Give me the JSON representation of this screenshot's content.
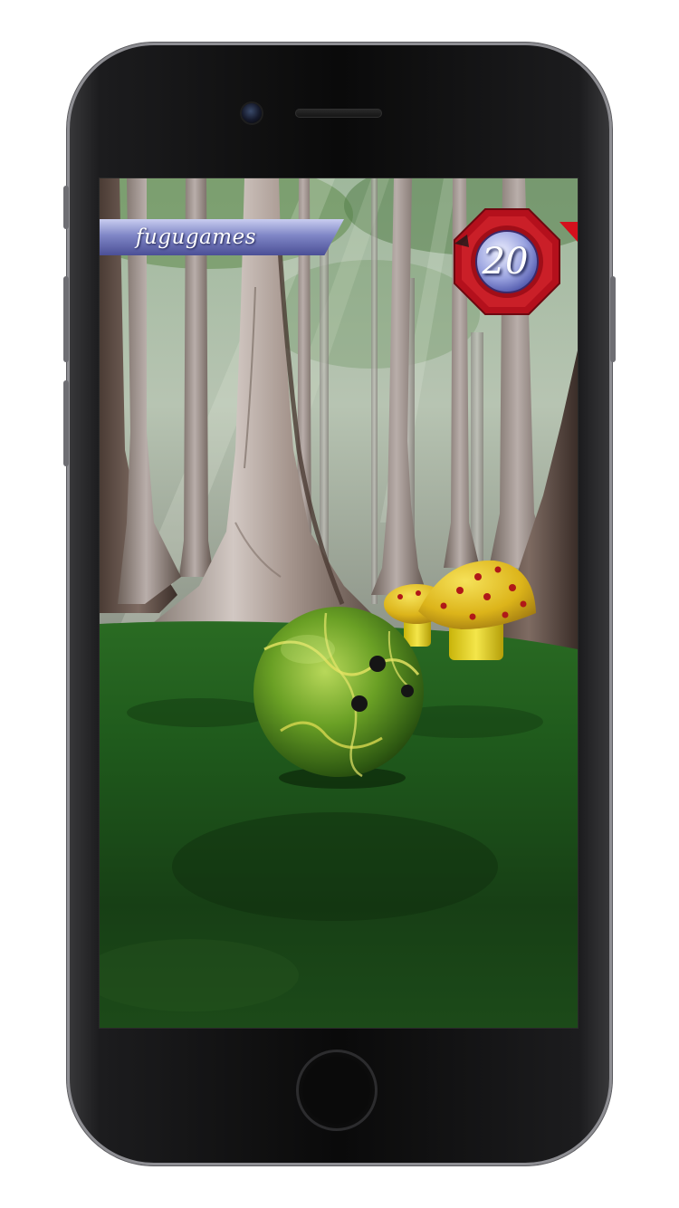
{
  "game": {
    "player_name": "fugugames",
    "timer_value": "20"
  },
  "colors": {
    "banner": "#7f86c6",
    "timer_ring": "#c0141e",
    "ball": "#6aa025",
    "mushroom_cap": "#e0b818",
    "mushroom_spot": "#b01818",
    "grass": "#1e5a1e"
  },
  "icons": {
    "timer": "octagon-timer-badge",
    "corner": "red-triangle-marker"
  }
}
